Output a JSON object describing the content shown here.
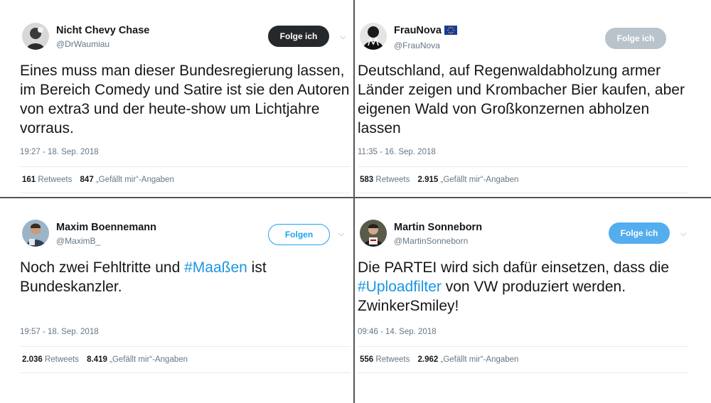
{
  "tweets": [
    {
      "display_name": "Nicht Chevy Chase",
      "handle": "@DrWaumiau",
      "follow_label": "Folge ich",
      "text": "Eines muss man dieser Bundesregierung lassen, im Bereich Comedy und Satire ist sie den Autoren von extra3 und der heute-show um Lichtjahre vorraus.",
      "timestamp": "19:27 - 18. Sep. 2018",
      "retweets_count": "161",
      "retweets_label": "Retweets",
      "likes_count": "847",
      "likes_label": "„Gefällt mir“-Angaben"
    },
    {
      "display_name": "FrauNova",
      "handle": "@FrauNova",
      "follow_label": "Folge ich",
      "text": "Deutschland, auf Regenwaldabholzung armer Länder zeigen und Krombacher Bier kaufen, aber eigenen Wald von Großkonzernen abholzen lassen",
      "timestamp": "11:35 - 16. Sep. 2018",
      "retweets_count": "583",
      "retweets_label": "Retweets",
      "likes_count": "2.915",
      "likes_label": "„Gefällt mir“-Angaben"
    },
    {
      "display_name": "Maxim Boennemann",
      "handle": "@MaximB_",
      "follow_label": "Folgen",
      "text_pre": "Noch zwei Fehltritte und ",
      "hashtag": "#Maaßen",
      "text_post": " ist Bundeskanzler.",
      "timestamp": "19:57 - 18. Sep. 2018",
      "retweets_count": "2.036",
      "retweets_label": "Retweets",
      "likes_count": "8.419",
      "likes_label": "„Gefällt mir“-Angaben"
    },
    {
      "display_name": "Martin Sonneborn",
      "handle": "@MartinSonneborn",
      "follow_label": "Folge ich",
      "text_pre": "Die PARTEI wird sich dafür einsetzen, dass die ",
      "hashtag": "#Uploadfilter",
      "text_post": " von VW produziert werden. ZwinkerSmiley!",
      "timestamp": "09:46 - 14. Sep. 2018",
      "retweets_count": "556",
      "retweets_label": "Retweets",
      "likes_count": "2.962",
      "likes_label": "„Gefällt mir“-Angaben"
    }
  ],
  "icons": {
    "menu": "chevron-down-icon",
    "flag": "eu-flag-icon"
  },
  "colors": {
    "link": "#1b95e0",
    "follow_dark": "#26292c",
    "follow_blue": "#54adef"
  }
}
